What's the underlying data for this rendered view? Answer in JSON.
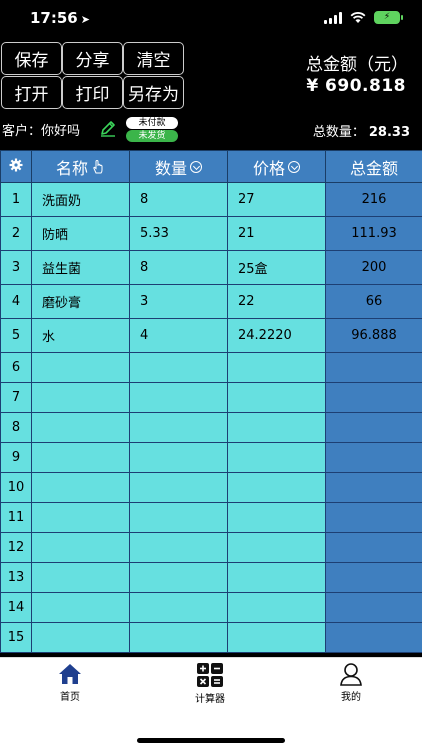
{
  "status": {
    "time": "17:56"
  },
  "toolbar": {
    "save": "保存",
    "share": "分享",
    "clear": "清空",
    "open": "打开",
    "print": "打印",
    "save_as": "另存为"
  },
  "summary": {
    "total_label": "总金额（元）",
    "total_value": "¥ 690.818",
    "quantity_label": "总数量：",
    "quantity_value": "28.33"
  },
  "customer": {
    "label": "客户：你好吗",
    "badge_unpaid": "未付款",
    "badge_unshipped": "未发货"
  },
  "table": {
    "headers": {
      "name": "名称",
      "quantity": "数量",
      "price": "价格",
      "amount": "总金额"
    },
    "rows": [
      {
        "index": "1",
        "name": "洗面奶",
        "quantity": "8",
        "price": "27",
        "amount": "216"
      },
      {
        "index": "2",
        "name": "防晒",
        "quantity": "5.33",
        "price": "21",
        "amount": "111.93"
      },
      {
        "index": "3",
        "name": "益生菌",
        "quantity": "8",
        "price": "25盒",
        "amount": "200"
      },
      {
        "index": "4",
        "name": "磨砂膏",
        "quantity": "3",
        "price": "22",
        "amount": "66"
      },
      {
        "index": "5",
        "name": "水",
        "quantity": "4",
        "price": "24.2220",
        "amount": "96.888"
      },
      {
        "index": "6",
        "name": "",
        "quantity": "",
        "price": "",
        "amount": ""
      },
      {
        "index": "7",
        "name": "",
        "quantity": "",
        "price": "",
        "amount": ""
      },
      {
        "index": "8",
        "name": "",
        "quantity": "",
        "price": "",
        "amount": ""
      },
      {
        "index": "9",
        "name": "",
        "quantity": "",
        "price": "",
        "amount": ""
      },
      {
        "index": "10",
        "name": "",
        "quantity": "",
        "price": "",
        "amount": ""
      },
      {
        "index": "11",
        "name": "",
        "quantity": "",
        "price": "",
        "amount": ""
      },
      {
        "index": "12",
        "name": "",
        "quantity": "",
        "price": "",
        "amount": ""
      },
      {
        "index": "13",
        "name": "",
        "quantity": "",
        "price": "",
        "amount": ""
      },
      {
        "index": "14",
        "name": "",
        "quantity": "",
        "price": "",
        "amount": ""
      },
      {
        "index": "15",
        "name": "",
        "quantity": "",
        "price": "",
        "amount": ""
      }
    ]
  },
  "tabs": {
    "home": "首页",
    "calculator": "计算器",
    "mine": "我的"
  },
  "colors": {
    "header": "#3f7fbf",
    "cell": "#66e0e0",
    "badge_green": "#3bb54a",
    "tab_active": "#1f3f8f"
  }
}
